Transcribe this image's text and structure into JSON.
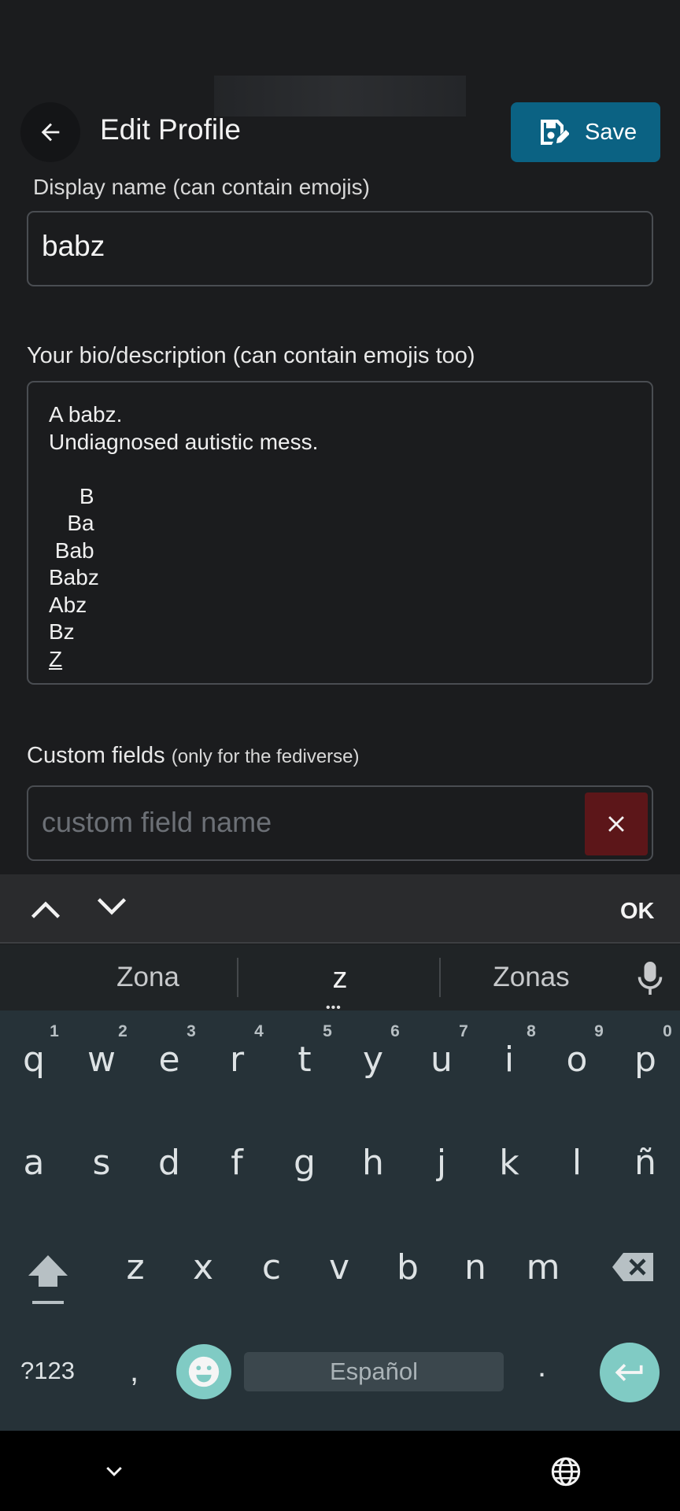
{
  "header": {
    "title": "Edit Profile",
    "save_label": "Save"
  },
  "form": {
    "display_name_label": "Display name (can contain emojis)",
    "display_name_value": "babz",
    "bio_label": "Your bio/description (can contain emojis too)",
    "bio_lines": [
      "A babz.",
      "Undiagnosed autistic mess.",
      "",
      "     B",
      "   Ba",
      " Bab",
      "Babz",
      "Abz",
      "Bz"
    ],
    "bio_last_line": "Z",
    "custom_fields_label": "Custom fields",
    "custom_fields_sublabel": "(only for the fediverse)",
    "custom_field_placeholder": "custom field name"
  },
  "keyboard_toolbar": {
    "ok_label": "OK"
  },
  "suggestions": [
    "Zona",
    "z",
    "Zonas"
  ],
  "keyboard": {
    "row1": [
      "q",
      "w",
      "e",
      "r",
      "t",
      "y",
      "u",
      "i",
      "o",
      "p"
    ],
    "row1_hints": [
      "1",
      "2",
      "3",
      "4",
      "5",
      "6",
      "7",
      "8",
      "9",
      "0"
    ],
    "row2": [
      "a",
      "s",
      "d",
      "f",
      "g",
      "h",
      "j",
      "k",
      "l",
      "ñ"
    ],
    "row3": [
      "z",
      "x",
      "c",
      "v",
      "b",
      "n",
      "m"
    ],
    "symbols_label": "?123",
    "comma": ",",
    "space_label": "Español",
    "period": "."
  },
  "icons": {
    "back": "arrow-left-icon",
    "save": "save-edit-icon",
    "clear": "close-icon",
    "mic": "microphone-icon",
    "emoji": "emoji-icon",
    "enter": "enter-icon",
    "shift": "shift-icon",
    "backspace": "backspace-icon",
    "nav_down": "chevron-down-icon",
    "language": "globe-icon"
  },
  "colors": {
    "save_button": "#0b6283",
    "clear_button": "#5c1619",
    "keyboard_bg": "#263238",
    "accent_key": "#80cbc4"
  }
}
